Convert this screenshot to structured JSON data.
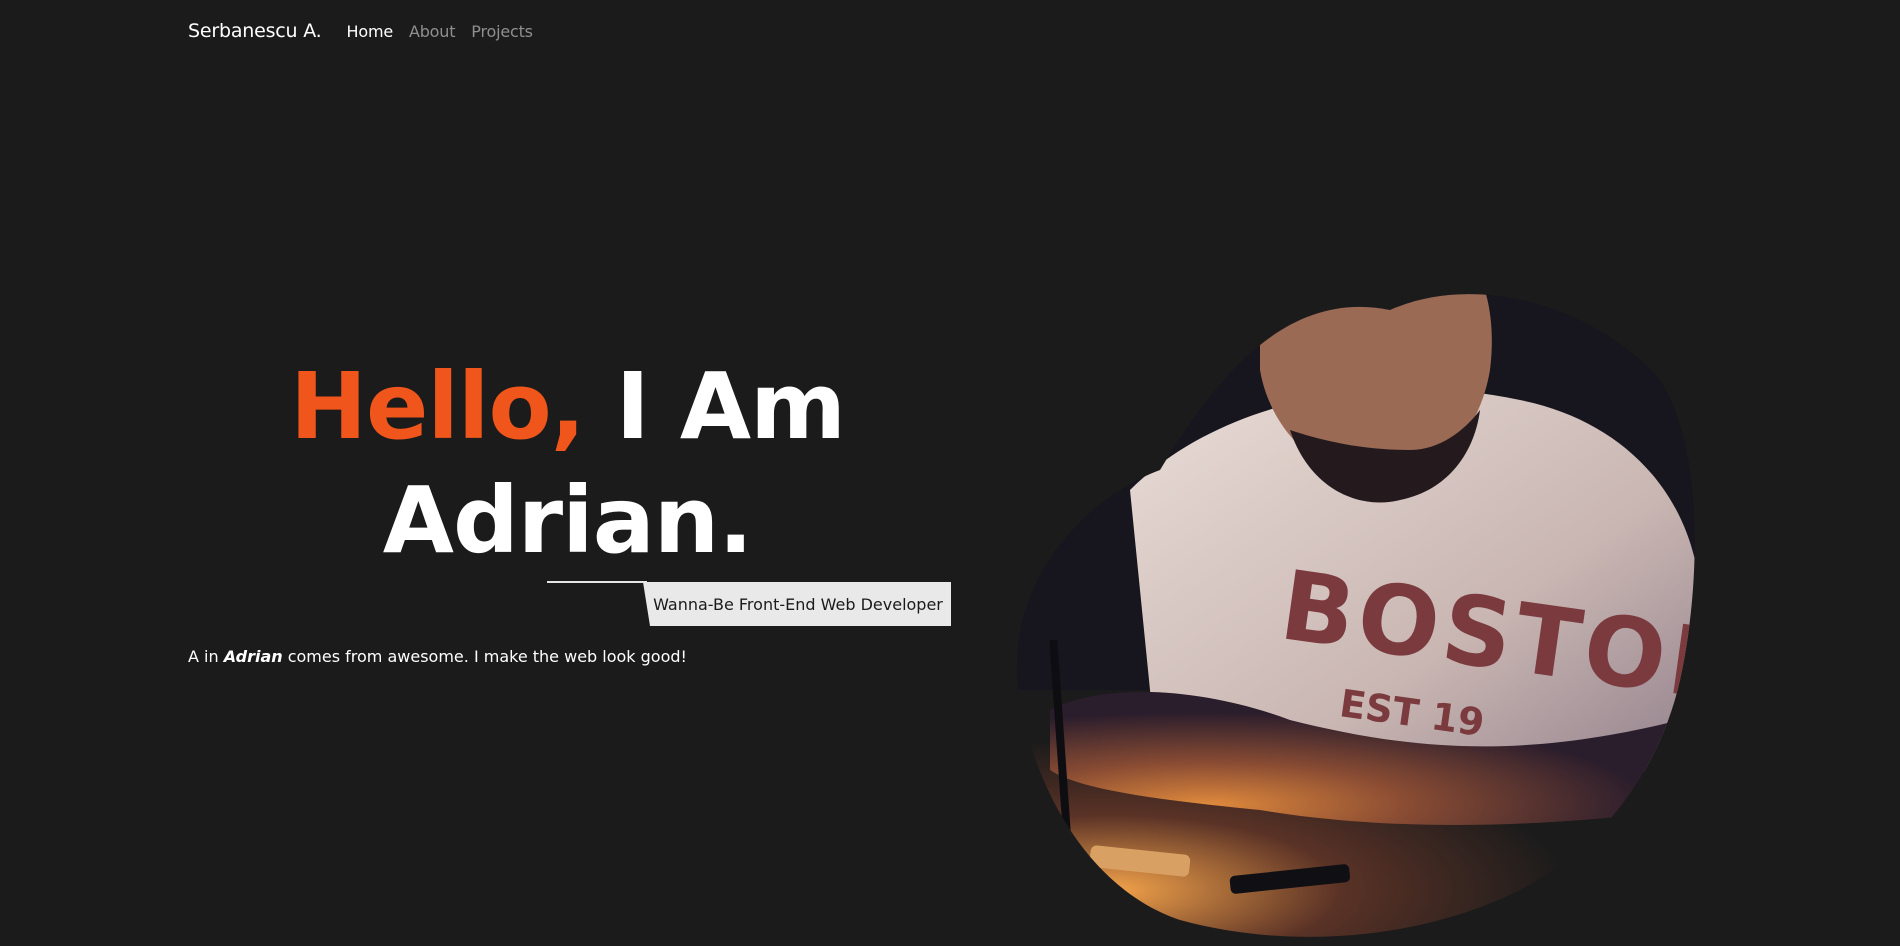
{
  "nav": {
    "brand": "Serbanescu A.",
    "links": [
      {
        "label": "Home",
        "active": true
      },
      {
        "label": "About",
        "active": false
      },
      {
        "label": "Projects",
        "active": false
      }
    ]
  },
  "hero": {
    "greeting": "Hello,",
    "title_rest": "I Am",
    "name": "Adrian.",
    "subtitle": "Wanna-Be Front-End Web Developer",
    "tagline_prefix": "A in",
    "tagline_name": "Adrian",
    "tagline_suffix": "comes from awesome. I make the web look good!"
  },
  "shirt_text": {
    "word": "BOSTON",
    "est": "EST 19"
  },
  "colors": {
    "background": "#1b1b1b",
    "accent": "#f0561b",
    "text": "#ffffff",
    "muted_nav": "#8f8f8f",
    "tag_background": "#e9e9e9"
  },
  "portrait": {
    "description_icon": "portrait-photo"
  }
}
